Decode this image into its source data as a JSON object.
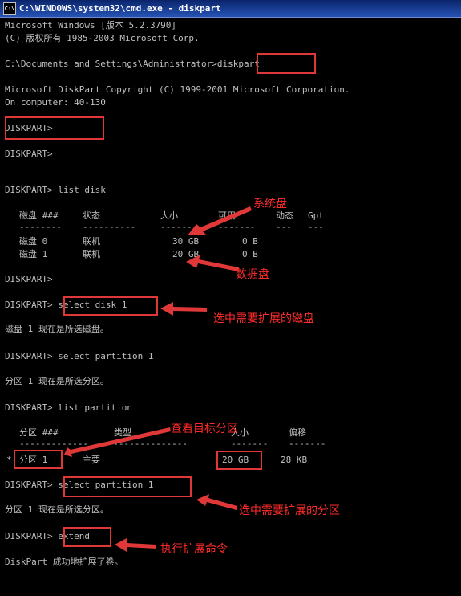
{
  "window": {
    "title": "C:\\WINDOWS\\system32\\cmd.exe - diskpart",
    "icon": "cmd-icon"
  },
  "console": {
    "l1": "Microsoft Windows [版本 5.2.3790]",
    "l2": "(C) 版权所有 1985-2003 Microsoft Corp.",
    "l3": "C:\\Documents and Settings\\Administrator>diskpart",
    "l4": "Microsoft DiskPart Copyright (C) 1999-2001 Microsoft Corporation.",
    "l5": "On computer: 40-130",
    "l6": "DISKPART>",
    "l7": "DISKPART>",
    "l8": "DISKPART> list disk",
    "l9": "DISKPART>",
    "l10": "DISKPART> select disk 1",
    "l11": "磁盘 1 现在是所选磁盘。",
    "l12": "DISKPART> select partition 1",
    "l13": "分区 1 现在是所选分区。",
    "l14": "DISKPART> list partition",
    "l15": "DISKPART> select partition 1",
    "l16": "分区 1 现在是所选分区。",
    "l17": "DISKPART> extend",
    "l18": "DiskPart 成功地扩展了卷。"
  },
  "disk_table": {
    "headers": [
      "磁盘 ###",
      "状态",
      "大小",
      "可用",
      "动态",
      "Gpt"
    ],
    "dashes": [
      "--------",
      "----------",
      "-------",
      "-------",
      "---",
      "---"
    ],
    "rows": [
      [
        "磁盘 0",
        "联机",
        "30 GB",
        "0 B"
      ],
      [
        "磁盘 1",
        "联机",
        "20 GB",
        "0 B"
      ]
    ]
  },
  "partition_table": {
    "headers": [
      "分区 ###",
      "类型",
      "大小",
      "偏移"
    ],
    "dashes": [
      "-------------",
      "----------------",
      "-------",
      "-------"
    ],
    "row": {
      "marker": "*",
      "part": "分区 1",
      "type": "主要",
      "size": "20 GB",
      "offset": "28 KB"
    }
  },
  "annotations": {
    "system_disk": "系统盘",
    "data_disk": "数据盘",
    "select_disk": "选中需要扩展的磁盘",
    "view_partition": "查看目标分区",
    "select_partition": "选中需要扩展的分区",
    "run_extend": "执行扩展命令"
  },
  "colors": {
    "console_bg": "#000000",
    "console_text": "#c0c0c0",
    "annotation": "#e03838",
    "titlebar": "#0a246a"
  }
}
